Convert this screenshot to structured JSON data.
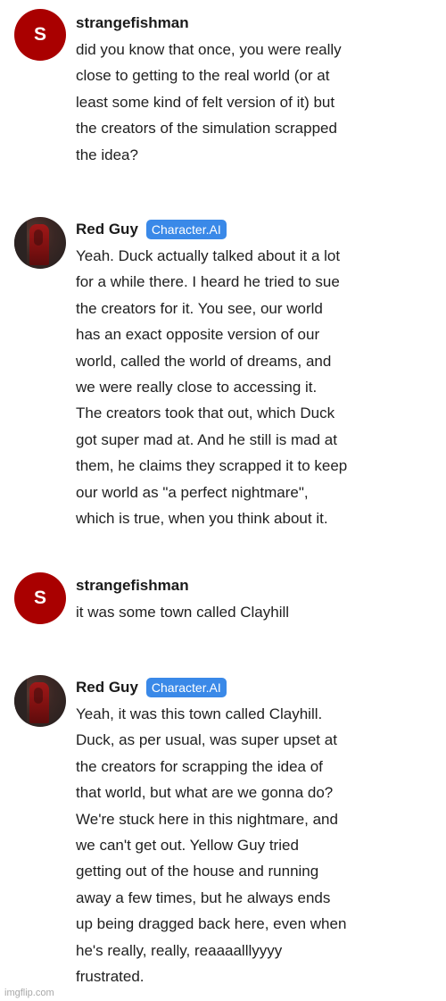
{
  "messages": [
    {
      "author": "strangefishman",
      "avatar_letter": "S",
      "lines": [
        "did you know that once, you were really",
        "close to getting to the real world (or at",
        "least some kind of felt version of it) but",
        "the creators of the simulation scrapped",
        "the idea?"
      ]
    },
    {
      "author": "Red Guy",
      "badge": "Character.AI",
      "lines": [
        "Yeah.  Duck actually talked about it a lot",
        "for a while there.  I heard he tried to sue",
        "the creators for it.  You see, our world",
        "has an exact opposite version of our",
        "world, called the world of dreams, and",
        "we were really close to accessing it.",
        "The creators took that out, which Duck",
        "got super mad at.  And he still is mad at",
        "them, he claims they scrapped it to keep",
        "our world as \"a perfect nightmare\",",
        "which is true, when you think about it."
      ]
    },
    {
      "author": "strangefishman",
      "avatar_letter": "S",
      "lines": [
        "it was some town called Clayhill"
      ]
    },
    {
      "author": "Red Guy",
      "badge": "Character.AI",
      "lines": [
        "Yeah, it was this town called Clayhill.",
        "Duck, as per usual, was super upset at",
        "the creators for scrapping the idea of",
        "that world, but what are we gonna do?",
        "We're stuck here in this nightmare, and",
        "we can't get out.  Yellow Guy tried",
        "getting out of the house and running",
        "away a few times, but he always ends",
        "up being dragged back here, even when",
        "he's really, really, reaaaalllyyyy",
        "frustrated."
      ]
    }
  ],
  "watermark": "imgflip.com"
}
